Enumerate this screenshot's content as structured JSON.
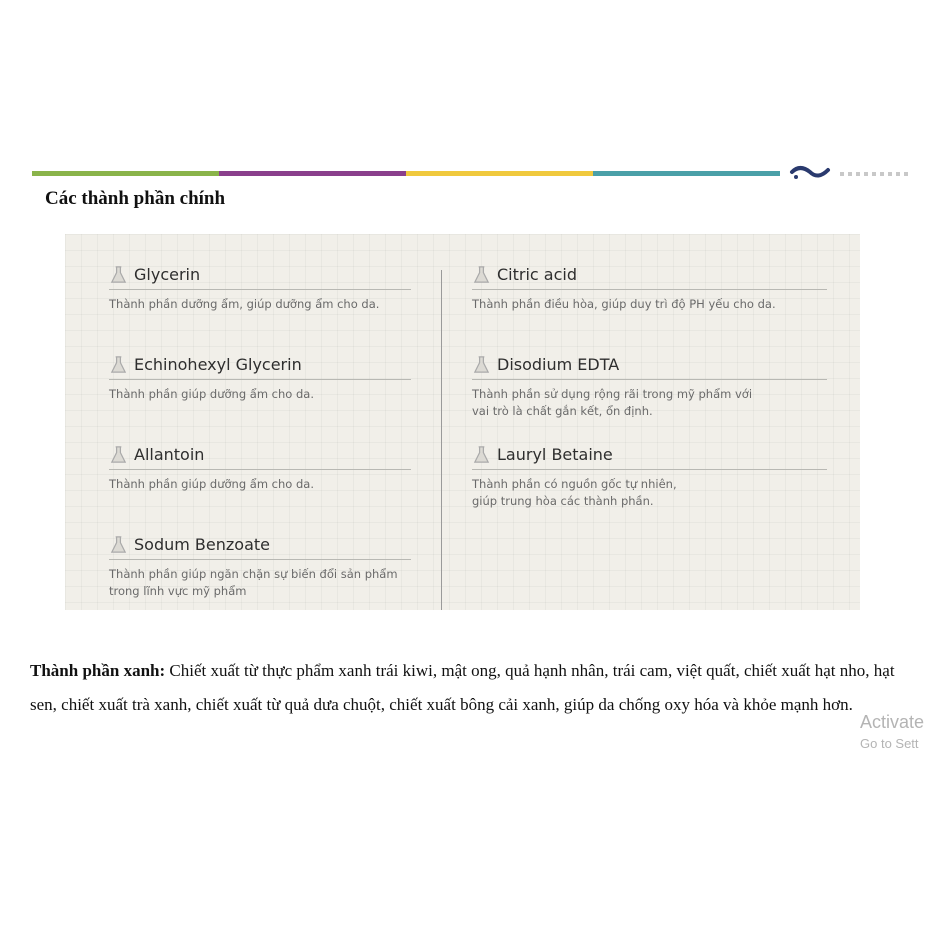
{
  "header": {
    "bar_colors": [
      "#8ab44a",
      "#8a3f8c",
      "#f0c93d",
      "#4aa0a8"
    ],
    "logo_color": "#2a3a6e"
  },
  "section_title": "Các thành phần chính",
  "panel": {
    "background": "#f1efe9",
    "left_column": [
      {
        "name": "Glycerin",
        "description": "Thành phần dưỡng ẩm, giúp dưỡng ẩm cho da.",
        "icon": "flask-icon"
      },
      {
        "name": "Echinohexyl Glycerin",
        "description": "Thành phần giúp dưỡng ẩm cho da.",
        "icon": "flask-icon"
      },
      {
        "name": "Allantoin",
        "description": "Thành phần giúp dưỡng ẩm cho da.",
        "icon": "flask-icon"
      },
      {
        "name": "Sodum Benzoate",
        "description": "Thành phần giúp ngăn chặn sự biến đổi sản phẩm\ntrong lĩnh vực mỹ phẩm",
        "icon": "flask-icon"
      }
    ],
    "right_column": [
      {
        "name": "Citric acid",
        "description": "Thành phần điều hòa, giúp duy trì độ PH yếu cho da.",
        "icon": "flask-icon"
      },
      {
        "name": "Disodium EDTA",
        "description": "Thành phần sử dụng rộng rãi trong mỹ phẩm với\nvai trò là chất gắn kết, ổn định.",
        "icon": "flask-icon"
      },
      {
        "name": "Lauryl Betaine",
        "description": "Thành phần có nguồn gốc tự nhiên,\ngiúp trung hòa các thành phần.",
        "icon": "flask-icon"
      }
    ]
  },
  "body": {
    "label": "Thành phần xanh:",
    "text": " Chiết xuất từ thực phẩm xanh trái kiwi, mật ong, quả hạnh nhân, trái cam, việt quất, chiết xuất hạt nho, hạt sen, chiết xuất trà xanh, chiết xuất từ quả dưa chuột, chiết xuất bông cải xanh, giúp da chống oxy hóa và khỏe mạnh hơn."
  },
  "watermark": {
    "line1": "Activate",
    "line2": "Go to Sett"
  }
}
